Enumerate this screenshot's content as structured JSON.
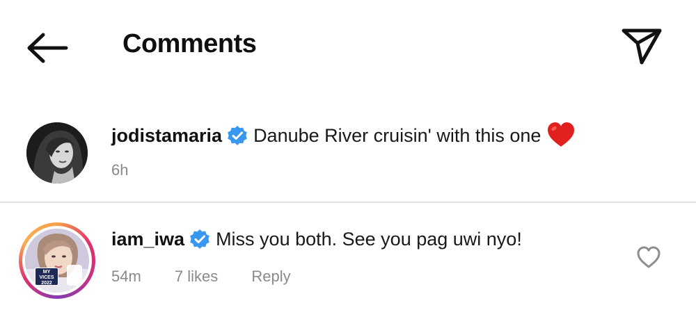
{
  "header": {
    "title": "Comments",
    "back_icon": "arrow-left-icon",
    "send_icon": "paper-plane-icon"
  },
  "caption": {
    "username": "jodistamaria",
    "verified": true,
    "text": "Danube River cruisin' with this one",
    "emoji": "red-heart-emoji",
    "time": "6h"
  },
  "comments": [
    {
      "username": "iam_iwa",
      "verified": true,
      "text": "Miss you both. See you pag uwi nyo!",
      "time": "54m",
      "likes": "7 likes",
      "reply_label": "Reply",
      "like_icon": "heart-outline-icon",
      "avatar_sticker": "MY VICES 2022"
    }
  ],
  "colors": {
    "verified_badge": "#3897f0",
    "heart": "#e0211f",
    "muted_text": "#8a8a8a",
    "divider": "#e3e3e3"
  }
}
